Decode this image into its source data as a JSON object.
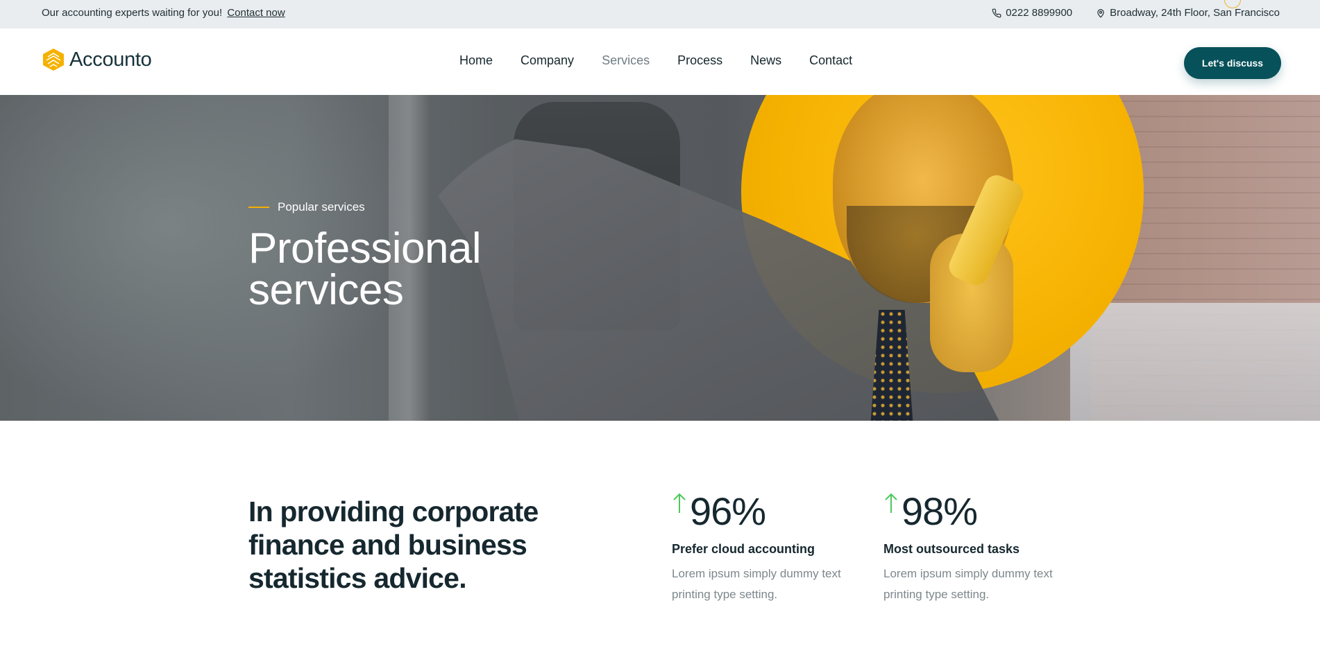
{
  "topbar": {
    "message": "Our accounting experts waiting for you!",
    "link": "Contact now",
    "phone": "0222 8899900",
    "address": "Broadway, 24th Floor, San Francisco"
  },
  "header": {
    "logo_text": "Accounto",
    "nav": [
      {
        "label": "Home"
      },
      {
        "label": "Company"
      },
      {
        "label": "Services"
      },
      {
        "label": "Process"
      },
      {
        "label": "News"
      },
      {
        "label": "Contact"
      }
    ],
    "active_nav": "Services",
    "cta": "Let's discuss"
  },
  "hero": {
    "eyebrow": "Popular services",
    "title_line1": "Professional",
    "title_line2": "services"
  },
  "intro": {
    "lead": "In providing corporate finance and business statistics advice.",
    "stats": [
      {
        "value": "96%",
        "label": "Prefer cloud accounting",
        "desc": "Lorem ipsum simply dummy text printing type setting."
      },
      {
        "value": "98%",
        "label": "Most outsourced tasks",
        "desc": "Lorem ipsum simply dummy text printing type setting."
      }
    ]
  },
  "colors": {
    "accent": "#f5b100",
    "primary": "#07515a",
    "up_arrow": "#4cc85a",
    "topbar_bg": "#e9edf0"
  }
}
